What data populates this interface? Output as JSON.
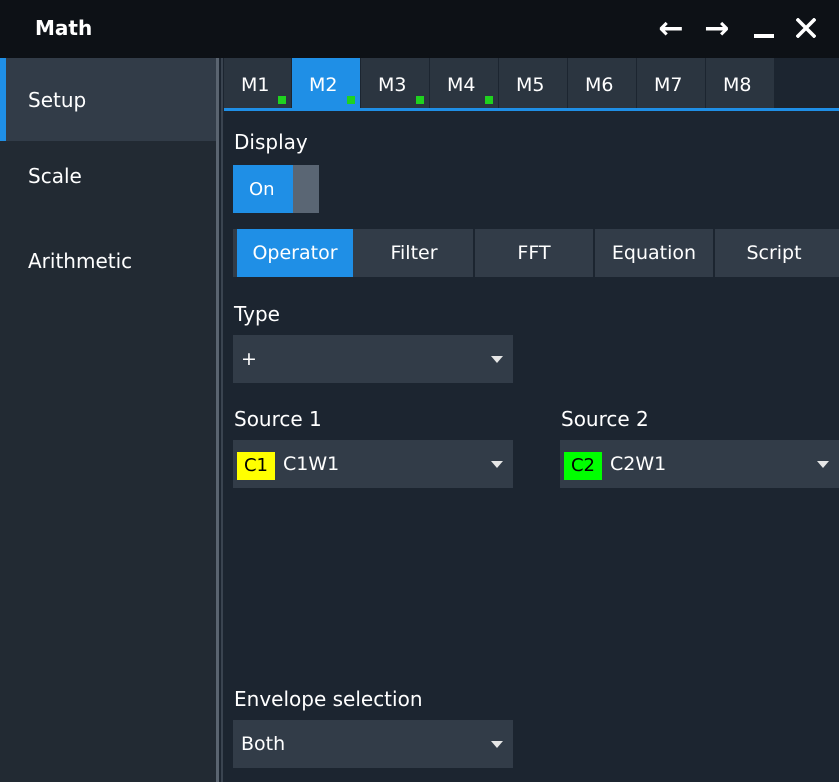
{
  "window": {
    "title": "Math",
    "controls": {
      "back": "←",
      "forward": "→",
      "minimize": "—",
      "close": "✕"
    }
  },
  "sidebar": {
    "items": [
      {
        "label": "Setup",
        "active": true
      },
      {
        "label": "Scale",
        "active": false
      },
      {
        "label": "Arithmetic",
        "active": false
      }
    ]
  },
  "tabs": [
    {
      "label": "M1",
      "active": false,
      "indicator": true
    },
    {
      "label": "M2",
      "active": true,
      "indicator": true
    },
    {
      "label": "M3",
      "active": false,
      "indicator": true
    },
    {
      "label": "M4",
      "active": false,
      "indicator": true
    },
    {
      "label": "M5",
      "active": false,
      "indicator": false
    },
    {
      "label": "M6",
      "active": false,
      "indicator": false
    },
    {
      "label": "M7",
      "active": false,
      "indicator": false
    },
    {
      "label": "M8",
      "active": false,
      "indicator": false
    }
  ],
  "display": {
    "label": "Display",
    "toggle_value": "On"
  },
  "modes": [
    {
      "label": "Operator",
      "active": true
    },
    {
      "label": "Filter",
      "active": false
    },
    {
      "label": "FFT",
      "active": false
    },
    {
      "label": "Equation",
      "active": false
    },
    {
      "label": "Script",
      "active": false
    }
  ],
  "type": {
    "label": "Type",
    "value": "+"
  },
  "source1": {
    "label": "Source 1",
    "badge": "C1",
    "badge_color": "#ffff00",
    "value": "C1W1"
  },
  "source2": {
    "label": "Source 2",
    "badge": "C2",
    "badge_color": "#00ff00",
    "value": "C2W1"
  },
  "envelope": {
    "label": "Envelope selection",
    "value": "Both"
  },
  "colors": {
    "accent": "#1f8fe6",
    "indicator": "#1fd21f"
  }
}
